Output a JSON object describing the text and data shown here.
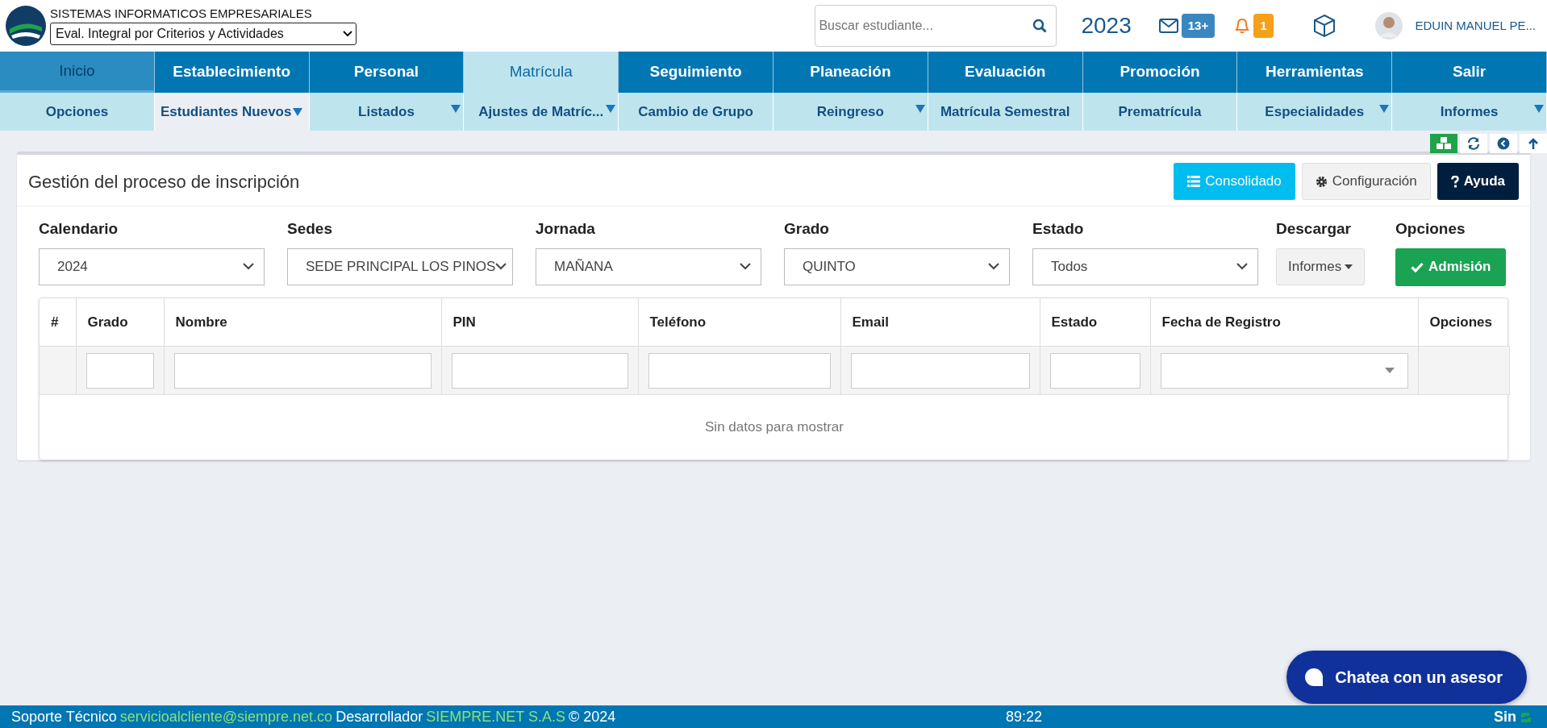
{
  "header": {
    "company": "SISTEMAS INFORMATICOS EMPRESARIALES",
    "module_select": "Eval. Integral por Criterios y Actividades",
    "search": {
      "placeholder": "Buscar estudiante..."
    },
    "year": "2023",
    "messages_badge": "13+",
    "notifications_badge": "1",
    "user_name": "EDUIN MANUEL PE..."
  },
  "menu": [
    {
      "label": "Inicio",
      "selected": false,
      "dimmed": true
    },
    {
      "label": "Establecimiento",
      "selected": false,
      "dimmed": false
    },
    {
      "label": "Personal",
      "selected": false,
      "dimmed": false
    },
    {
      "label": "Matrícula",
      "selected": true,
      "dimmed": false
    },
    {
      "label": "Seguimiento",
      "selected": false,
      "dimmed": false
    },
    {
      "label": "Planeación",
      "selected": false,
      "dimmed": false
    },
    {
      "label": "Evaluación",
      "selected": false,
      "dimmed": false
    },
    {
      "label": "Promoción",
      "selected": false,
      "dimmed": false
    },
    {
      "label": "Herramientas",
      "selected": false,
      "dimmed": false
    },
    {
      "label": "Salir",
      "selected": false,
      "dimmed": false
    }
  ],
  "submenu": [
    {
      "label": "Opciones",
      "selected": false,
      "dropdown": false
    },
    {
      "label": "Estudiantes Nuevos",
      "selected": true,
      "dropdown": true
    },
    {
      "label": "Listados",
      "selected": false,
      "dropdown": true
    },
    {
      "label": "Ajustes de Matríc...",
      "selected": false,
      "dropdown": true
    },
    {
      "label": "Cambio de Grupo",
      "selected": false,
      "dropdown": false
    },
    {
      "label": "Reingreso",
      "selected": false,
      "dropdown": true
    },
    {
      "label": "Matrícula Semestral",
      "selected": false,
      "dropdown": false
    },
    {
      "label": "Prematrícula",
      "selected": false,
      "dropdown": false
    },
    {
      "label": "Especialidades",
      "selected": false,
      "dropdown": true
    },
    {
      "label": "Informes",
      "selected": false,
      "dropdown": true
    }
  ],
  "card": {
    "title": "Gestión del proceso de inscripción",
    "buttons": [
      {
        "label": "Consolidado",
        "kind": "info"
      },
      {
        "label": "Configuración",
        "kind": "light"
      },
      {
        "label": "Ayuda",
        "kind": "dark"
      }
    ],
    "filters": [
      {
        "label": "Calendario",
        "kind": "select",
        "value": "2024"
      },
      {
        "label": "Sedes",
        "kind": "select",
        "value": "SEDE PRINCIPAL LOS PINOS"
      },
      {
        "label": "Jornada",
        "kind": "select",
        "value": "MAÑANA"
      },
      {
        "label": "Grado",
        "kind": "select",
        "value": "QUINTO"
      },
      {
        "label": "Estado",
        "kind": "select",
        "value": "Todos"
      },
      {
        "label": "Descargar",
        "kind": "dropdown",
        "value": "Informes"
      },
      {
        "label": "Opciones",
        "kind": "action",
        "value": "Admisión"
      }
    ],
    "table": {
      "columns": [
        {
          "label": "#",
          "kind": "plain"
        },
        {
          "label": "Grado",
          "kind": "input"
        },
        {
          "label": "Nombre",
          "kind": "input"
        },
        {
          "label": "PIN",
          "kind": "input"
        },
        {
          "label": "Teléfono",
          "kind": "input"
        },
        {
          "label": "Email",
          "kind": "input"
        },
        {
          "label": "Estado",
          "kind": "input"
        },
        {
          "label": "Fecha de Registro",
          "kind": "select"
        },
        {
          "label": "Opciones",
          "kind": "plain"
        }
      ],
      "empty_message": "Sin datos para mostrar"
    }
  },
  "chat_button": "Chatea con un asesor",
  "footer": {
    "segments": [
      {
        "text": "Soporte Técnico",
        "kind": "text"
      },
      {
        "text": "servicioalcliente@siempre.net.co",
        "kind": "link"
      },
      {
        "text": "Desarrollador",
        "kind": "text"
      },
      {
        "text": "SIEMPRE.NET S.A.S",
        "kind": "link"
      },
      {
        "text": "© 2024",
        "kind": "text"
      }
    ],
    "time": "89:22",
    "brand": "Sin"
  }
}
